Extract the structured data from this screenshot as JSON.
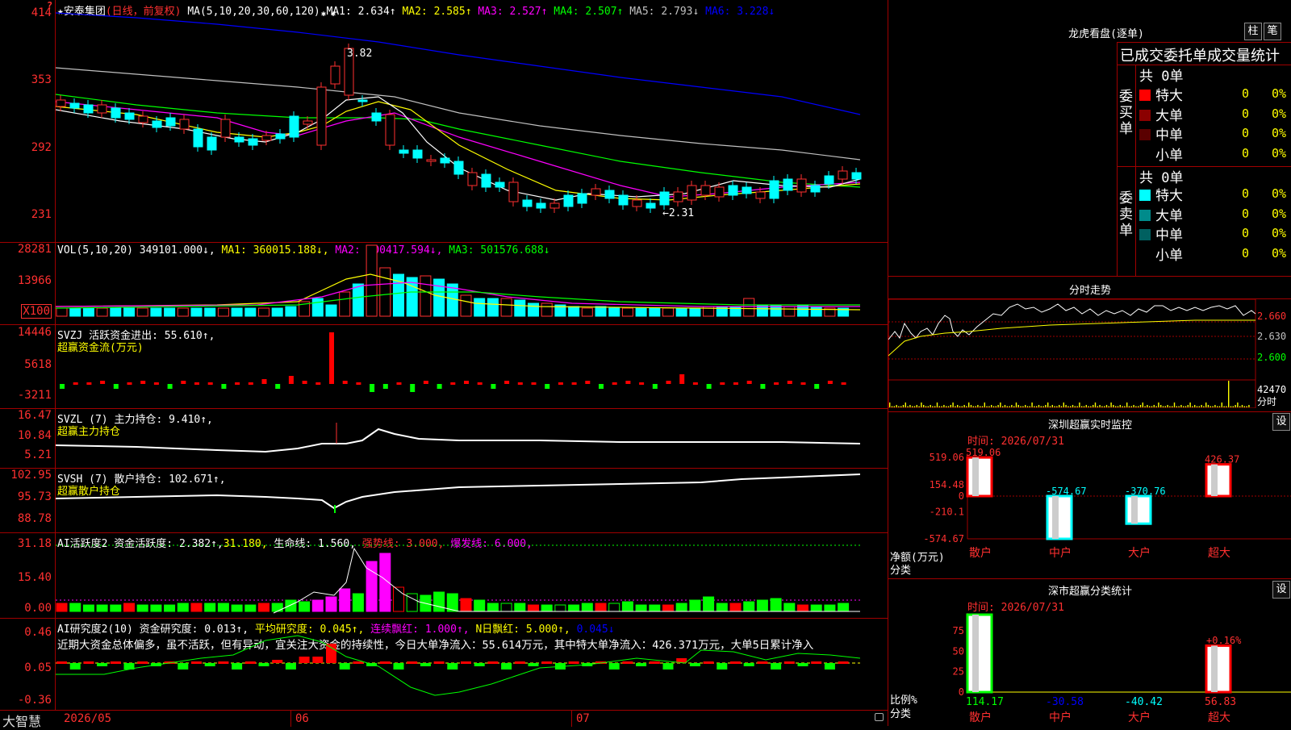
{
  "app": {
    "name": "大智慧",
    "corner_marker": "?"
  },
  "kline": {
    "title": "★安泰集团",
    "mode": "(日线，前复权)",
    "ma_params": "MA(5,10,20,30,60,120)",
    "stars": "✱ ✱",
    "ma": [
      {
        "label": "MA1: 2.634↑",
        "color": "#ffffff"
      },
      {
        "label": "MA2: 2.585↑",
        "color": "#ffff00"
      },
      {
        "label": "MA3: 2.527↑",
        "color": "#ff00ff"
      },
      {
        "label": "MA4: 2.507↑",
        "color": "#00ff00"
      },
      {
        "label": "MA5: 2.793↓",
        "color": "#c0c0c0"
      },
      {
        "label": "MA6: 3.228↓",
        "color": "#0000ff"
      }
    ],
    "y_ticks": [
      "414",
      "353",
      "292",
      "231"
    ],
    "high_note": "3.82",
    "low_note": "←2.31"
  },
  "vol": {
    "title": "VOL(5,10,20)",
    "value": "349101.000↓,",
    "ma": [
      {
        "label": "MA1: 360015.188↓,",
        "color": "#ffff00"
      },
      {
        "label": "MA2: 500417.594↓,",
        "color": "#ff00ff"
      },
      {
        "label": "MA3: 501576.688↓",
        "color": "#00ff00"
      }
    ],
    "y_ticks": [
      "28281",
      "13966"
    ],
    "unit": "X100"
  },
  "svzj": {
    "title": "SVZJ  活跃资金进出: 55.610↑,",
    "subtitle": "超赢资金流(万元)",
    "y_ticks": [
      "14446",
      "5618",
      "-3211"
    ]
  },
  "svzl": {
    "title": "SVZL (7) 主力持仓: 9.410↑,",
    "subtitle": "超赢主力持仓",
    "y_ticks": [
      "16.47",
      "10.84",
      "5.21"
    ]
  },
  "svsh": {
    "title": "SVSH (7) 散户持仓: 102.671↑,",
    "subtitle": "超赢散户持仓",
    "y_ticks": [
      "102.95",
      "95.73",
      "88.78"
    ]
  },
  "ai1": {
    "title": "AI活跃度2 资金活跃度: 2.382↑,",
    "v2": "31.180,",
    "v3": "生命线: 1.560,",
    "v4": "强势线: 3.000,",
    "v5": "爆发线: 6.000,",
    "y_ticks": [
      "31.18",
      "15.40",
      "0.00"
    ]
  },
  "ai2": {
    "title": "AI研究度2(10) 资金研究度: 0.013↑,",
    "v2": "平均研究度: 0.045↑,",
    "v3": "连续飘红: 1.000↑,",
    "v4": "N日飘红: 5.000↑,",
    "v5": "0.045↓",
    "comment": "近期大资金总体偏多，虽不活跃，但有异动，宜关注大资金的持续性，今日大单净流入：55.614万元，其中特大单净流入：426.371万元，大单5日累计净入",
    "y_ticks": [
      "0.46",
      "0.05",
      "-0.36"
    ]
  },
  "xaxis": {
    "labels": [
      "2026/05",
      "06",
      "07"
    ]
  },
  "lhb": {
    "title": "龙虎看盘(逐单)",
    "btn1": "柱",
    "btn2": "笔",
    "header": "已成交委托单成交量统计",
    "buy_label": "委买单",
    "sell_label": "委卖单",
    "buy_total": "共 0单",
    "sell_total": "共 0单",
    "buy_rows": [
      {
        "label": "特大",
        "count": "0",
        "pct": "0%",
        "color": "#ff0000"
      },
      {
        "label": "大单",
        "count": "0",
        "pct": "0%",
        "color": "#8b0000"
      },
      {
        "label": "中单",
        "count": "0",
        "pct": "0%",
        "color": "#5a0000"
      },
      {
        "label": "小单",
        "count": "0",
        "pct": "0%",
        "color": "#000000"
      }
    ],
    "sell_rows": [
      {
        "label": "特大",
        "count": "0",
        "pct": "0%",
        "color": "#00ffff"
      },
      {
        "label": "大单",
        "count": "0",
        "pct": "0%",
        "color": "#008b8b"
      },
      {
        "label": "中单",
        "count": "0",
        "pct": "0%",
        "color": "#006060"
      },
      {
        "label": "小单",
        "count": "0",
        "pct": "0%",
        "color": "#000000"
      }
    ]
  },
  "fenshi": {
    "title": "分时走势",
    "y_ticks": [
      "2.660",
      "2.630",
      "2.600"
    ],
    "vol_tick": "42470",
    "vol_label": "分时"
  },
  "sz_monitor": {
    "title": "深圳超赢实时监控",
    "btn": "设",
    "time": "时间: 2026/07/31",
    "y_ticks": [
      "519.06",
      "154.48",
      "0",
      "-210.1",
      "-574.67"
    ],
    "unit": "净额(万元)",
    "cat_label": "分类",
    "categories": [
      "散户",
      "中户",
      "大户",
      "超大"
    ],
    "values": [
      519.06,
      -574.67,
      -370.76,
      426.37
    ],
    "value_labels": [
      "519.06",
      "-574.67",
      "-370.76",
      "426.37"
    ]
  },
  "sz_stats": {
    "title": "深市超赢分类统计",
    "btn": "设",
    "time": "时间: 2026/07/31",
    "y_ticks": [
      "75",
      "50",
      "25",
      "0"
    ],
    "unit": "比例%",
    "cat_label": "分类",
    "categories": [
      "散户",
      "中户",
      "大户",
      "超大"
    ],
    "values": [
      114.17,
      -30.58,
      -40.42,
      56.83
    ],
    "value_labels": [
      "114.17",
      "-30.58",
      "-40.42",
      "56.83"
    ],
    "delta_label": "+0.16%"
  }
}
